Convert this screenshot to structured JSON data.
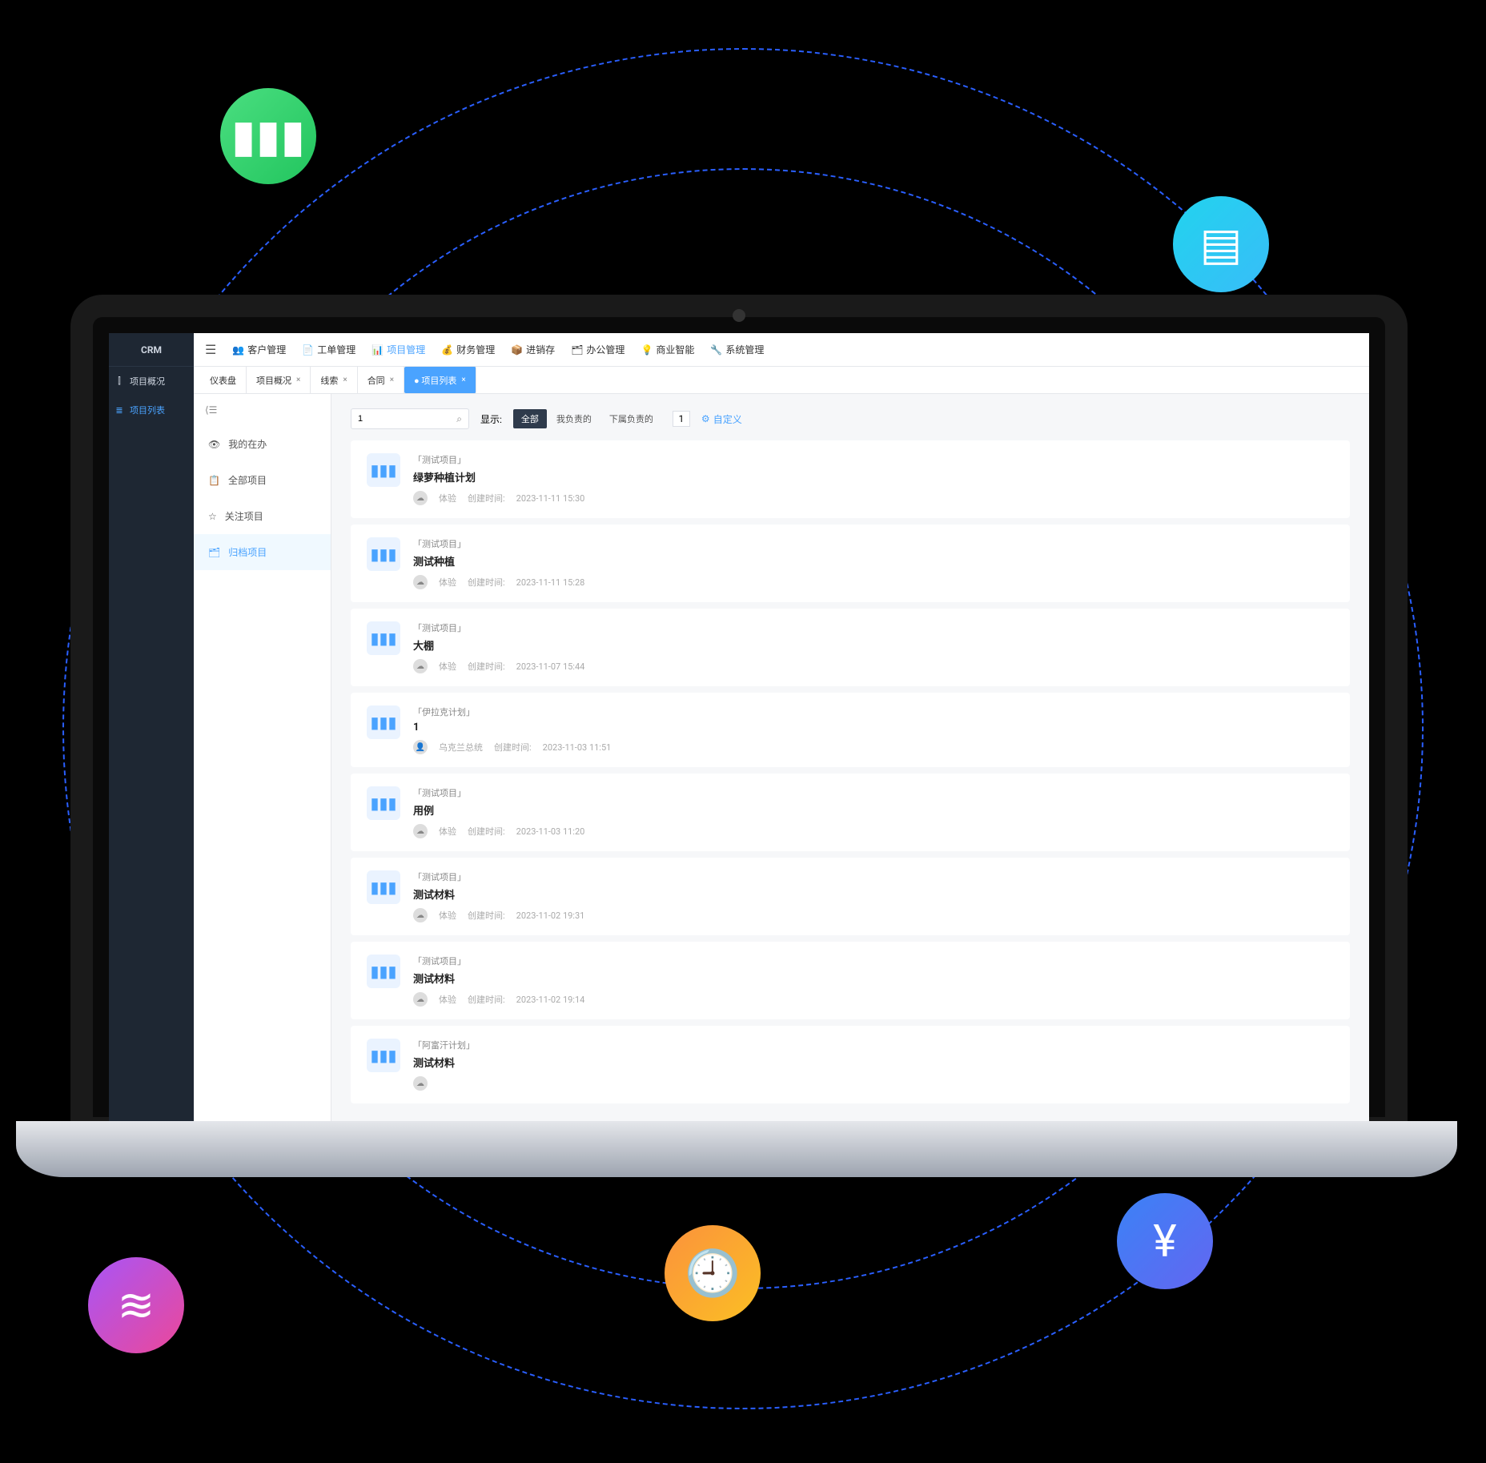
{
  "decor": {
    "icons": [
      "books",
      "tray",
      "layers",
      "doc-clock",
      "yen-book"
    ]
  },
  "brand": "CRM",
  "rail": {
    "items": [
      {
        "icon": "bar",
        "label": "项目概况"
      },
      {
        "icon": "list",
        "label": "项目列表"
      }
    ],
    "active_index": 1
  },
  "topnav": {
    "layout_icon": "☰",
    "items": [
      {
        "icon": "👥",
        "label": "客户管理"
      },
      {
        "icon": "📄",
        "label": "工单管理"
      },
      {
        "icon": "📊",
        "label": "项目管理"
      },
      {
        "icon": "💰",
        "label": "财务管理"
      },
      {
        "icon": "📦",
        "label": "进销存"
      },
      {
        "icon": "🗂",
        "label": "办公管理"
      },
      {
        "icon": "💡",
        "label": "商业智能"
      },
      {
        "icon": "🔧",
        "label": "系统管理"
      }
    ],
    "active_index": 2
  },
  "tabs": {
    "items": [
      {
        "label": "仪表盘",
        "closable": false
      },
      {
        "label": "项目概况",
        "closable": true
      },
      {
        "label": "线索",
        "closable": true
      },
      {
        "label": "合同",
        "closable": true
      },
      {
        "label": "● 项目列表",
        "closable": true
      }
    ],
    "active_index": 4
  },
  "sidemenu": {
    "collapse_glyph": "⟨☰",
    "items": [
      {
        "icon": "👁",
        "label": "我的在办"
      },
      {
        "icon": "📋",
        "label": "全部项目"
      },
      {
        "icon": "☆",
        "label": "关注项目"
      },
      {
        "icon": "🗂",
        "label": "归档项目"
      }
    ],
    "active_index": 3
  },
  "toolbar": {
    "search_value": "1",
    "display_label": "显示:",
    "filters": [
      "全部",
      "我负责的",
      "下属负责的"
    ],
    "filter_active_index": 0,
    "count_box": "1",
    "custom_label": "自定义"
  },
  "projects": [
    {
      "tag": "「测试项目」",
      "title": "绿萝种植计划",
      "owner": "体验",
      "owner_icon": "avatar",
      "time_label": "创建时间:",
      "time": "2023-11-11 15:30"
    },
    {
      "tag": "「测试项目」",
      "title": "测试种植",
      "owner": "体验",
      "owner_icon": "avatar",
      "time_label": "创建时间:",
      "time": "2023-11-11 15:28"
    },
    {
      "tag": "「测试项目」",
      "title": "大棚",
      "owner": "体验",
      "owner_icon": "avatar",
      "time_label": "创建时间:",
      "time": "2023-11-07 15:44"
    },
    {
      "tag": "「伊拉克计划」",
      "title": "1",
      "owner": "乌克兰总统",
      "owner_icon": "person",
      "time_label": "创建时间:",
      "time": "2023-11-03 11:51"
    },
    {
      "tag": "「测试项目」",
      "title": "用例",
      "owner": "体验",
      "owner_icon": "avatar",
      "time_label": "创建时间:",
      "time": "2023-11-03 11:20"
    },
    {
      "tag": "「测试项目」",
      "title": "测试材料",
      "owner": "体验",
      "owner_icon": "avatar",
      "time_label": "创建时间:",
      "time": "2023-11-02 19:31"
    },
    {
      "tag": "「测试项目」",
      "title": "测试材料",
      "owner": "体验",
      "owner_icon": "avatar",
      "time_label": "创建时间:",
      "time": "2023-11-02 19:14"
    },
    {
      "tag": "「阿富汗计划」",
      "title": "测试材料",
      "owner": "",
      "owner_icon": "avatar",
      "time_label": "",
      "time": ""
    }
  ]
}
